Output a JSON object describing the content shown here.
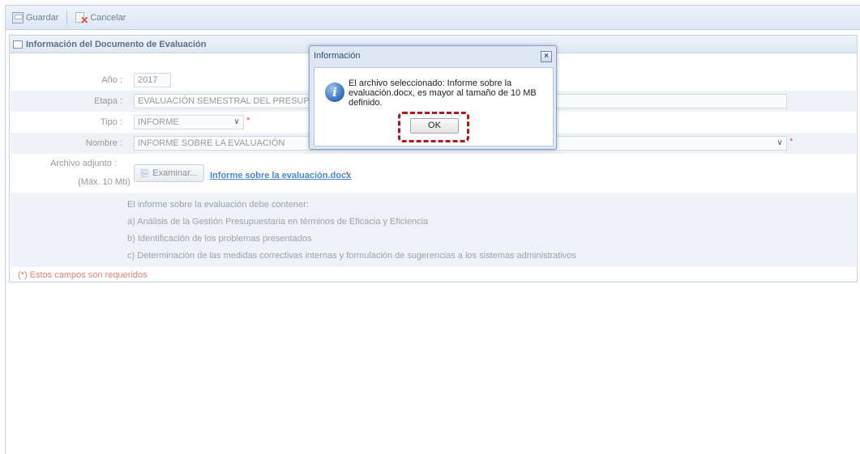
{
  "toolbar": {
    "save_label": "Guardar",
    "cancel_label": "Cancelar"
  },
  "panel": {
    "title": "Información del Documento de Evaluación"
  },
  "form": {
    "anio_label": "Año :",
    "anio_value": "2017",
    "etapa_label": "Etapa :",
    "etapa_value": "EVALUACIÓN SEMESTRAL DEL PRESUPUESTO",
    "tipo_label": "Tipo :",
    "tipo_value": "INFORME",
    "nombre_label": "Nombre :",
    "nombre_value": "INFORME SOBRE LA EVALUACIÓN",
    "archivo_label": "Archivo adjunto :",
    "archivo_sublabel": "(Máx. 10 Mb)",
    "examinar_label": "Examinar...",
    "file_name": "Informe sobre la evaluación.docx",
    "required_mark": "*"
  },
  "info": {
    "intro": "El informe sobre la evaluación debe contener:",
    "items": [
      "a) Análisis de la Gestión Presupuestaria en términos de Eficacia y Eficiencia",
      "b) Identificación de los problemas presentados",
      "c) Determinación de las medidas correctivas internas y formulación de sugerencias a los sistemas administrativos"
    ]
  },
  "required_note": "(*) Estos campos son requeridos",
  "dialog": {
    "title": "Información",
    "close_glyph": "×",
    "icon_glyph": "i",
    "message": "El archivo seleccionado: Informe sobre la evaluación.docx, es mayor al tamaño de 10 MB definido.",
    "ok_label": "OK"
  },
  "icons": {
    "select_arrow": "∨",
    "clip": "⎘"
  },
  "colors": {
    "accent": "#4a87c8",
    "required": "#e74c3c",
    "highlight": "#b0191c"
  }
}
